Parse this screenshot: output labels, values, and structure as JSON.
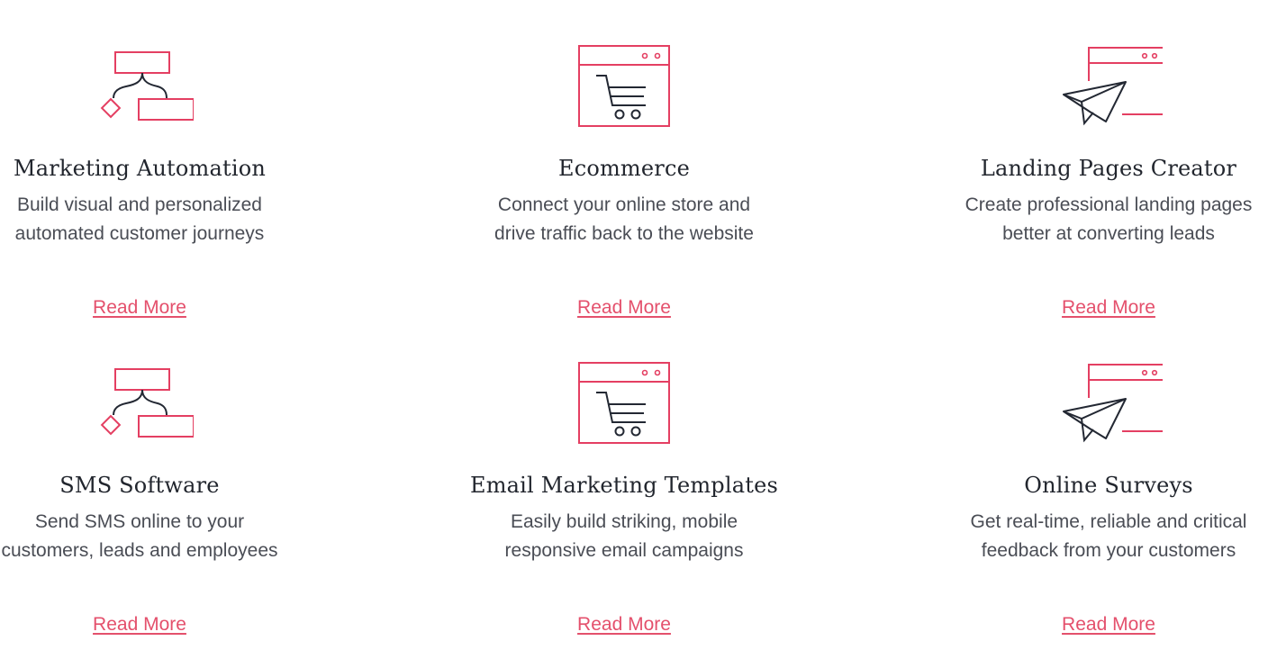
{
  "colors": {
    "accent": "#e43f62",
    "link": "#e4506c",
    "title": "#22262e",
    "text": "#4a4d55",
    "icon_dark": "#232833"
  },
  "features": [
    {
      "icon": "workflow-icon",
      "title": "Marketing Automation",
      "desc_line1": "Build visual and personalized",
      "desc_line2": "automated customer journeys",
      "link": "Read More"
    },
    {
      "icon": "shopping-cart-browser-icon",
      "title": "Ecommerce",
      "desc_line1": "Connect your online store and",
      "desc_line2": "drive traffic back to the website",
      "link": "Read More"
    },
    {
      "icon": "paper-plane-browser-icon",
      "title": "Landing Pages Creator",
      "desc_line1": "Create professional landing pages",
      "desc_line2": "better at converting leads",
      "link": "Read More"
    },
    {
      "icon": "workflow-icon",
      "title": "SMS Software",
      "desc_line1": "Send SMS online to your",
      "desc_line2": "customers, leads and employees",
      "link": "Read More"
    },
    {
      "icon": "shopping-cart-browser-icon",
      "title": "Email Marketing Templates",
      "desc_line1": "Easily build striking, mobile",
      "desc_line2": "responsive email campaigns",
      "link": "Read More"
    },
    {
      "icon": "paper-plane-browser-icon",
      "title": "Online Surveys",
      "desc_line1": "Get real-time, reliable and critical",
      "desc_line2": "feedback from your customers",
      "link": "Read More"
    }
  ]
}
